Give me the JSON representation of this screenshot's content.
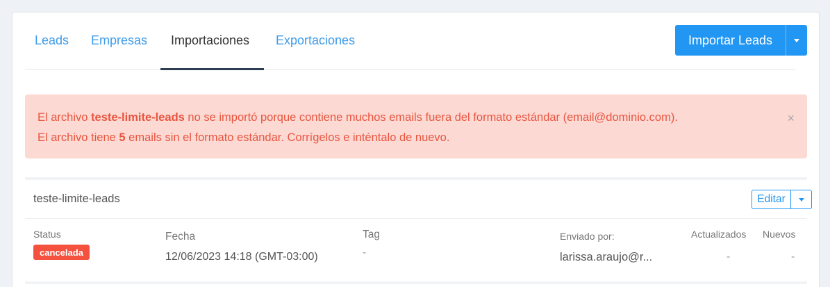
{
  "tabs": [
    {
      "label": "Leads",
      "active": false
    },
    {
      "label": "Empresas",
      "active": false
    },
    {
      "label": "Importaciones",
      "active": true
    },
    {
      "label": "Exportaciones",
      "active": false
    }
  ],
  "import_button": {
    "label": "Importar Leads"
  },
  "alert": {
    "line1_prefix": "El archivo ",
    "line1_file": "teste-limite-leads",
    "line1_suffix": " no se importó porque contiene muchos emails fuera del formato estándar (email@dominio.com).",
    "line2_prefix": "El archivo tiene ",
    "line2_count": "5",
    "line2_suffix": " emails sin el formato estándar. Corrígelos e inténtalo de nuevo.",
    "close": "×"
  },
  "import": {
    "name": "teste-limite-leads",
    "edit_label": "Editar",
    "columns": {
      "status": "Status",
      "fecha": "Fecha",
      "tag": "Tag",
      "enviado": "Enviado por:",
      "actualizados": "Actualizados",
      "nuevos": "Nuevos"
    },
    "values": {
      "status": "cancelada",
      "fecha": "12/06/2023 14:18 (GMT-03:00)",
      "tag": "-",
      "enviado": "larissa.araujo@r...",
      "actualizados": "-",
      "nuevos": "-"
    }
  },
  "colors": {
    "accent": "#2196f3",
    "alert_bg": "#fdd9d4",
    "alert_text": "#e8553f",
    "badge": "#f4513e"
  }
}
